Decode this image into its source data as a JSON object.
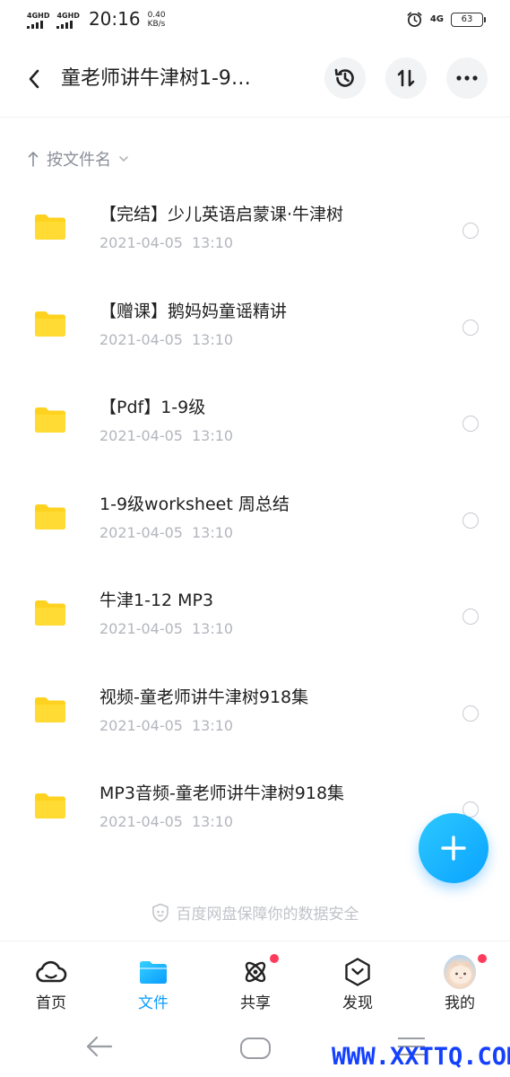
{
  "status_bar": {
    "sim1": "4GHD",
    "sim2": "4GHD",
    "time": "20:16",
    "speed_value": "0.40",
    "speed_unit": "KB/s",
    "network": "4G",
    "battery": "63",
    "icons": [
      "alarm-icon",
      "battery-icon"
    ]
  },
  "header": {
    "title": "童老师讲牛津树1-9…",
    "buttons": [
      "back-icon",
      "history-icon",
      "sort-icon",
      "more-icon"
    ]
  },
  "sort": {
    "label": "按文件名"
  },
  "files": [
    {
      "name": "【完结】少儿英语启蒙课·牛津树",
      "date": "2021-04-05",
      "time": "13:10"
    },
    {
      "name": "【赠课】鹅妈妈童谣精讲",
      "date": "2021-04-05",
      "time": "13:10"
    },
    {
      "name": "【Pdf】1-9级",
      "date": "2021-04-05",
      "time": "13:10"
    },
    {
      "name": "1-9级worksheet 周总结",
      "date": "2021-04-05",
      "time": "13:10"
    },
    {
      "name": "牛津1-12 MP3",
      "date": "2021-04-05",
      "time": "13:10"
    },
    {
      "name": "视频-童老师讲牛津树918集",
      "date": "2021-04-05",
      "time": "13:10"
    },
    {
      "name": "MP3音频-童老师讲牛津树918集",
      "date": "2021-04-05",
      "time": "13:10"
    }
  ],
  "security_note": "百度网盘保障你的数据安全",
  "bottom_nav": [
    {
      "label": "首页",
      "icon": "home-cloud-icon",
      "active": false
    },
    {
      "label": "文件",
      "icon": "folder-icon",
      "active": true
    },
    {
      "label": "共享",
      "icon": "share-atom-icon",
      "active": false
    },
    {
      "label": "发现",
      "icon": "discover-icon",
      "active": false
    },
    {
      "label": "我的",
      "icon": "avatar",
      "active": false
    }
  ],
  "watermark": "WWW.XXTTQ.COM",
  "colors": {
    "accent": "#0a9cff",
    "folder": "#ffd21f",
    "badge": "#ff3b5c",
    "watermark": "#1440ff"
  }
}
